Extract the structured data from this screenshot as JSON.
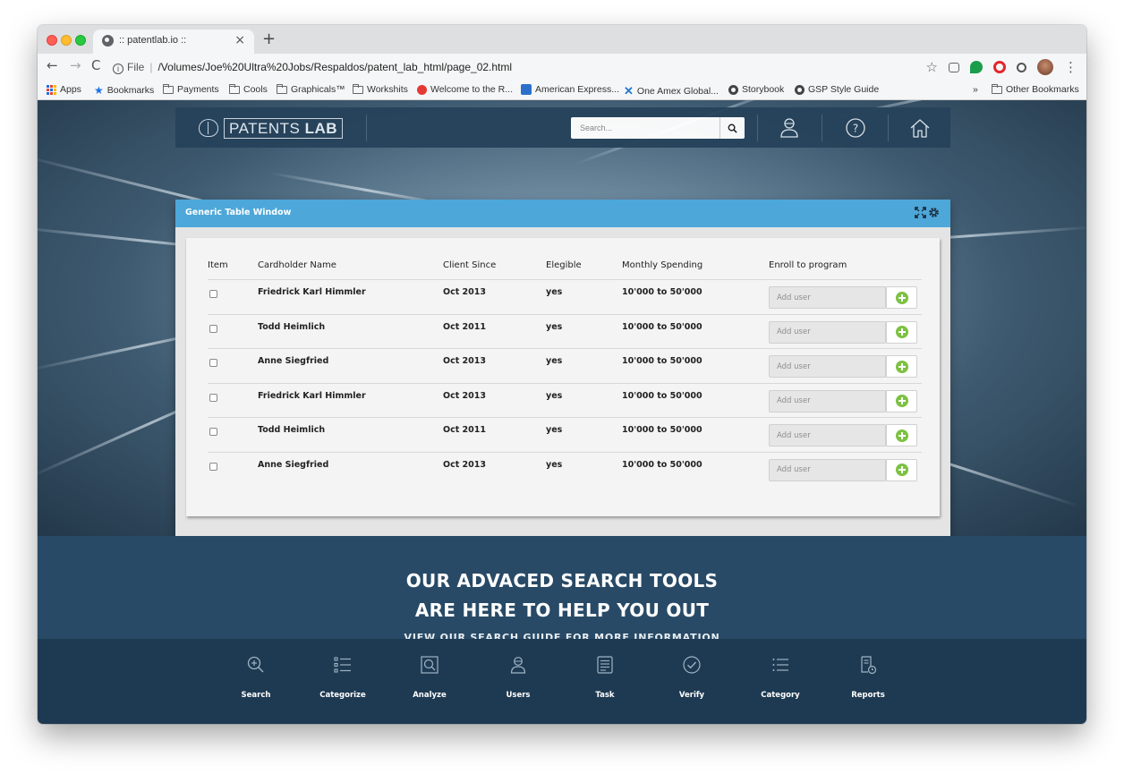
{
  "browser": {
    "tab_title": ":: patentlab.io ::",
    "tab_close": "×",
    "new_tab": "+",
    "address": {
      "info": "i",
      "scheme": "File",
      "separator": "|",
      "url": "/Volumes/Joe%20Ultra%20Jobs/Respaldos/patent_lab_html/page_02.html"
    },
    "bookmarks": [
      {
        "label": "Apps",
        "icon": "apps-icon"
      },
      {
        "label": "Bookmarks",
        "icon": "star-icon"
      },
      {
        "label": "Payments",
        "icon": "folder-icon"
      },
      {
        "label": "Cools",
        "icon": "folder-icon"
      },
      {
        "label": "Graphicals™",
        "icon": "folder-icon"
      },
      {
        "label": "Workshits",
        "icon": "folder-icon"
      },
      {
        "label": "Welcome to the R...",
        "icon": "red-circle-icon"
      },
      {
        "label": "American Express...",
        "icon": "amex-icon"
      },
      {
        "label": "One Amex Global...",
        "icon": "x-logo-icon"
      },
      {
        "label": "Storybook",
        "icon": "globe-icon"
      },
      {
        "label": "GSP Style Guide",
        "icon": "globe-icon"
      }
    ],
    "bookmarks_more": "»",
    "other_bookmarks": "Other Bookmarks"
  },
  "header": {
    "logo_text_light": "PATENTS",
    "logo_text_bold": "LAB",
    "search_placeholder": "Search...",
    "icons": [
      "search-icon",
      "user-icon",
      "help-icon",
      "home-icon"
    ]
  },
  "table_window": {
    "title": "Generic Table Window",
    "columns": [
      "Item",
      "Cardholder Name",
      "Client Since",
      "Elegible",
      "Monthly Spending",
      "Enroll to program"
    ],
    "add_placeholder": "Add user",
    "rows": [
      {
        "name": "Friedrick Karl Himmler",
        "since": "Oct 2013",
        "elegible": "yes",
        "spending": "10'000 to 50'000"
      },
      {
        "name": "Todd Heimlich",
        "since": "Oct 2011",
        "elegible": "yes",
        "spending": "10'000 to 50'000"
      },
      {
        "name": "Anne Siegfried",
        "since": "Oct 2013",
        "elegible": "yes",
        "spending": "10'000 to 50'000"
      },
      {
        "name": "Friedrick Karl Himmler",
        "since": "Oct 2013",
        "elegible": "yes",
        "spending": "10'000 to 50'000"
      },
      {
        "name": "Todd Heimlich",
        "since": "Oct 2011",
        "elegible": "yes",
        "spending": "10'000 to 50'000"
      },
      {
        "name": "Anne Siegfried",
        "since": "Oct 2013",
        "elegible": "yes",
        "spending": "10'000 to 50'000"
      }
    ]
  },
  "promo": {
    "line1": "OUR ADVACED SEARCH TOOLS",
    "line2": "ARE HERE TO HELP YOU OUT",
    "sub": "VIEW OUR SEARCH GUIDE FOR MORE INFORMATION"
  },
  "footer": {
    "items": [
      {
        "label": "Search",
        "icon": "zoom-in-icon"
      },
      {
        "label": "Categorize",
        "icon": "list-icon"
      },
      {
        "label": "Analyze",
        "icon": "analyze-icon"
      },
      {
        "label": "Users",
        "icon": "user-icon"
      },
      {
        "label": "Task",
        "icon": "task-icon"
      },
      {
        "label": "Verify",
        "icon": "check-circle-icon"
      },
      {
        "label": "Category",
        "icon": "category-list-icon"
      },
      {
        "label": "Reports",
        "icon": "report-icon"
      }
    ]
  },
  "colors": {
    "header_bar": "#27435b",
    "table_header": "#4da7d9",
    "add_button": "#7cc242",
    "promo_bg": "#284a66",
    "footer_bg": "#1e3a52"
  }
}
